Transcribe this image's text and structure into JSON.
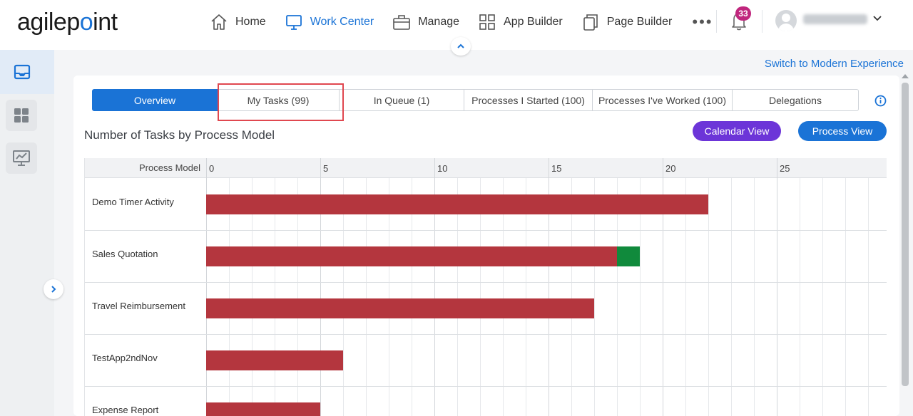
{
  "brand": {
    "logo_text_pre": "agilep",
    "logo_text_dot": "o",
    "logo_text_post": "int"
  },
  "nav": {
    "items": [
      {
        "label": "Home",
        "icon": "home-icon",
        "active": false
      },
      {
        "label": "Work Center",
        "icon": "monitor-icon",
        "active": true
      },
      {
        "label": "Manage",
        "icon": "briefcase-icon",
        "active": false
      },
      {
        "label": "App Builder",
        "icon": "grid-icon",
        "active": false
      },
      {
        "label": "Page Builder",
        "icon": "pages-icon",
        "active": false
      }
    ],
    "more": "•••",
    "notifications_count": "33"
  },
  "switch_link": "Switch to Modern Experience",
  "tabs": [
    {
      "label": "Overview",
      "active": true
    },
    {
      "label": "My Tasks (99)",
      "active": false
    },
    {
      "label": "In Queue (1)",
      "active": false
    },
    {
      "label": "Processes I Started (100)",
      "active": false
    },
    {
      "label": "Processes I've Worked (100)",
      "active": false
    },
    {
      "label": "Delegations",
      "active": false
    }
  ],
  "chart_title": "Number of Tasks by Process Model",
  "buttons": {
    "calendar_view": "Calendar View",
    "process_view": "Process View"
  },
  "colors": {
    "primary": "#1a73d6",
    "purple": "#6c35d8",
    "bar_red": "#b4363e",
    "bar_green": "#108a3c",
    "highlight": "#e0474f"
  },
  "chart_data": {
    "type": "bar",
    "orientation": "horizontal",
    "y_header": "Process Model",
    "categories": [
      "Demo Timer Activity",
      "Sales Quotation",
      "Travel Reimbursement",
      "TestApp2ndNov",
      "Expense Report"
    ],
    "series": [
      {
        "values": [
          22,
          18,
          17,
          6,
          5
        ],
        "color": "#b4363e"
      },
      {
        "values": [
          0,
          1,
          0,
          0,
          0
        ],
        "color": "#108a3c"
      }
    ],
    "x_ticks": [
      0,
      5,
      10,
      15,
      20,
      25
    ],
    "xlim": [
      0,
      29
    ],
    "grid": true
  }
}
